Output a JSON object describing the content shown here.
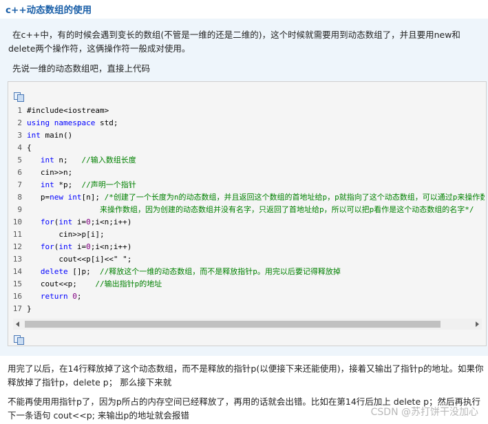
{
  "title": "c++动态数组的使用",
  "intro": "在c++中，有的时候会遇到变长的数组(不管是一维的还是二维的)，这个时候就需要用到动态数组了，并且要用new和delete两个操作符，这俩操作符一般成对使用。",
  "lead": "先说一维的动态数组吧，直接上代码",
  "code_lines": [
    {
      "n": "1",
      "parts": [
        [
          "#include<iostream>",
          ""
        ]
      ]
    },
    {
      "n": "2",
      "parts": [
        [
          "using",
          "kw"
        ],
        [
          " ",
          ""
        ],
        [
          "namespace",
          "kw"
        ],
        [
          " std;",
          ""
        ]
      ]
    },
    {
      "n": "3",
      "parts": [
        [
          "int",
          "kw"
        ],
        [
          " main()",
          ""
        ]
      ]
    },
    {
      "n": "4",
      "parts": [
        [
          "{",
          ""
        ]
      ]
    },
    {
      "n": "5",
      "parts": [
        [
          "   ",
          ""
        ],
        [
          "int",
          "kw"
        ],
        [
          " n;   ",
          ""
        ],
        [
          "//输入数组长度",
          "cm"
        ]
      ]
    },
    {
      "n": "6",
      "parts": [
        [
          "   cin>>n;",
          ""
        ]
      ]
    },
    {
      "n": "7",
      "parts": [
        [
          "   ",
          ""
        ],
        [
          "int",
          "kw"
        ],
        [
          " *p;  ",
          ""
        ],
        [
          "//声明一个指针",
          "cm"
        ]
      ]
    },
    {
      "n": "8",
      "parts": [
        [
          "   p=",
          ""
        ],
        [
          "new",
          "kw"
        ],
        [
          " ",
          ""
        ],
        [
          "int",
          "kw"
        ],
        [
          "[n]; ",
          ""
        ],
        [
          "/*创建了一个长度为n的动态数组，并且返回这个数组的首地址给p，p就指向了这个动态数组，可以通过p来操作数组",
          "cm"
        ]
      ]
    },
    {
      "n": "9",
      "parts": [
        [
          "                ",
          ""
        ],
        [
          "来操作数组，因为创建的动态数组并没有名字，只返回了首地址给p，所以可以把p看作是这个动态数组的名字*/",
          "cm"
        ]
      ]
    },
    {
      "n": "10",
      "parts": [
        [
          "   ",
          ""
        ],
        [
          "for",
          "kw"
        ],
        [
          "(",
          ""
        ],
        [
          "int",
          "kw"
        ],
        [
          " i=",
          ""
        ],
        [
          "0",
          "num"
        ],
        [
          ";i<n;i++)",
          ""
        ]
      ]
    },
    {
      "n": "11",
      "parts": [
        [
          "       cin>>p[i];",
          ""
        ]
      ]
    },
    {
      "n": "12",
      "parts": [
        [
          "   ",
          ""
        ],
        [
          "for",
          "kw"
        ],
        [
          "(",
          ""
        ],
        [
          "int",
          "kw"
        ],
        [
          " i=",
          ""
        ],
        [
          "0",
          "num"
        ],
        [
          ";i<n;i++)",
          ""
        ]
      ]
    },
    {
      "n": "13",
      "parts": [
        [
          "       cout<<p[i]<<\" \";",
          ""
        ]
      ]
    },
    {
      "n": "14",
      "parts": [
        [
          "   ",
          ""
        ],
        [
          "delete",
          "kw"
        ],
        [
          " []p;  ",
          ""
        ],
        [
          "//释放这个一维的动态数组，而不是释放指针p。用完以后要记得释放掉",
          "cm"
        ]
      ]
    },
    {
      "n": "15",
      "parts": [
        [
          "   cout<<p;    ",
          ""
        ],
        [
          "//输出指针p的地址",
          "cm"
        ]
      ]
    },
    {
      "n": "16",
      "parts": [
        [
          "   ",
          ""
        ],
        [
          "return",
          "kw"
        ],
        [
          " ",
          ""
        ],
        [
          "0",
          "num"
        ],
        [
          ";",
          ""
        ]
      ]
    },
    {
      "n": "17",
      "parts": [
        [
          "}",
          ""
        ]
      ]
    }
  ],
  "after_para1": "用完了以后，在14行释放掉了这个动态数组，而不是释放的指针p(以便接下来还能使用)，接着又输出了指针p的地址。如果你释放掉了指针p，delete p； 那么接下来就",
  "after_para2": "不能再使用用指针p了，因为p所占的内存空间已经释放了，再用的话就会出错。比如在第14行后加上 delete p；然后再执行下一条语句 cout<<p; 来输出p的地址就会报错",
  "watermark": "CSDN @苏打饼干没加心"
}
